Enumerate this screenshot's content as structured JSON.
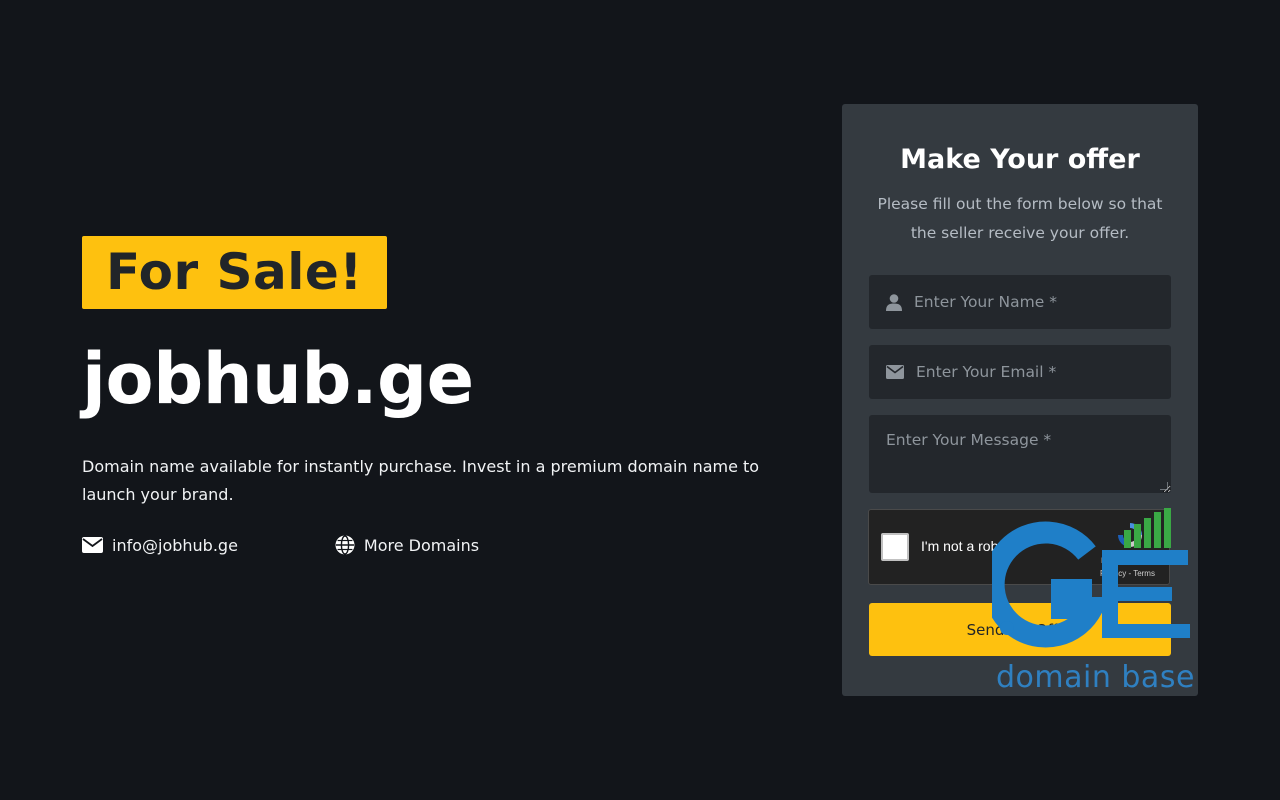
{
  "hero": {
    "badge": "For Sale!",
    "domain": "jobhub.ge",
    "description": "Domain name available for instantly purchase. Invest in a premium domain name to launch your brand.",
    "email": "info@jobhub.ge",
    "more_domains": "More Domains"
  },
  "form": {
    "title": "Make Your offer",
    "subtitle": "Please fill out the form below so that the seller receive your offer.",
    "name_placeholder": "Enter Your Name *",
    "email_placeholder": "Enter Your Email *",
    "message_placeholder": "Enter Your Message *",
    "submit_label": "Send My Offer"
  },
  "captcha": {
    "label": "I'm not a robot",
    "brand": "reCAPTCHA",
    "links": "Privacy - Terms"
  },
  "watermark": {
    "caption": "domain base"
  },
  "colors": {
    "background": "#12151a",
    "accent": "#fec10f",
    "card": "#343a40",
    "input": "#23272c",
    "watermark_blue": "#1f7fc8",
    "watermark_green": "#3aa845"
  }
}
